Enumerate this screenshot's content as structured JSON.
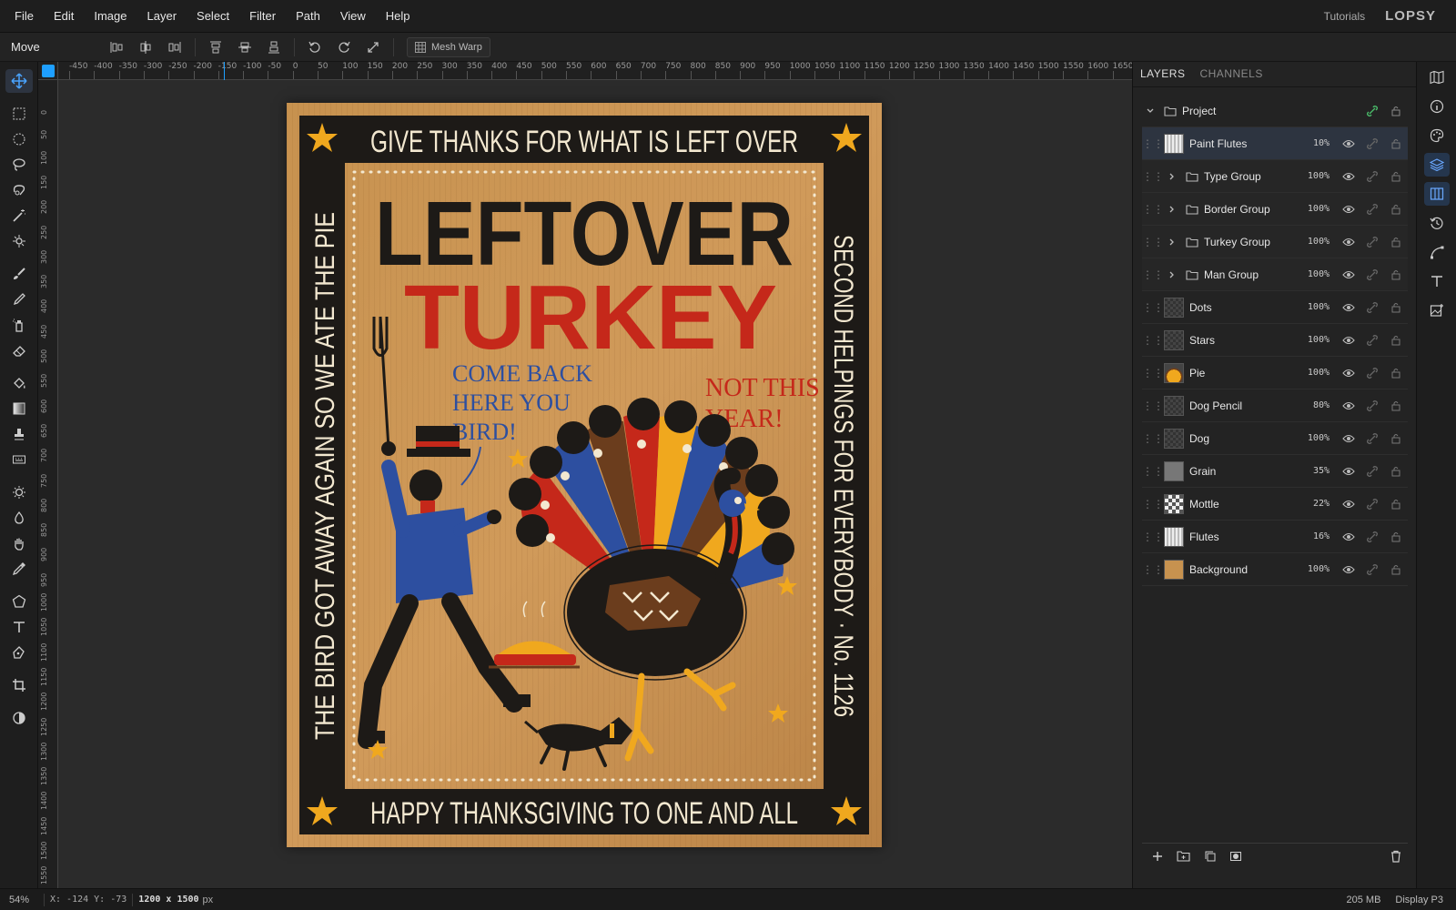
{
  "menubar": {
    "items": [
      "File",
      "Edit",
      "Image",
      "Layer",
      "Select",
      "Filter",
      "Path",
      "View",
      "Help"
    ],
    "tutorials": "Tutorials",
    "logo": "LOPSY"
  },
  "options": {
    "tool_name": "Move",
    "mesh_warp": "Mesh Warp"
  },
  "rulers": {
    "top": [
      "-450",
      "-400",
      "-350",
      "-300",
      "-250",
      "-200",
      "-150",
      "-100",
      "-50",
      "0",
      "50",
      "100",
      "150",
      "200",
      "250",
      "300",
      "350",
      "400",
      "450",
      "500",
      "550",
      "600",
      "650",
      "700",
      "750",
      "800",
      "850",
      "900",
      "950",
      "1000",
      "1050",
      "1100",
      "1150",
      "1200",
      "1250",
      "1300",
      "1350",
      "1400",
      "1450",
      "1500",
      "1550",
      "1600",
      "1650"
    ],
    "left": [
      "0",
      "50",
      "100",
      "150",
      "200",
      "250",
      "300",
      "350",
      "400",
      "450",
      "500",
      "550",
      "600",
      "650",
      "700",
      "750",
      "800",
      "850",
      "900",
      "950",
      "1000",
      "1050",
      "1100",
      "1150",
      "1200",
      "1250",
      "1300",
      "1350",
      "1400",
      "1450",
      "1500",
      "1550"
    ]
  },
  "poster": {
    "top": "GIVE THANKS FOR WHAT IS LEFT OVER",
    "bottom": "HAPPY THANKSGIVING TO ONE AND ALL",
    "left": "THE BIRD GOT AWAY AGAIN SO WE ATE THE PIE",
    "right": "SECOND HELPINGS FOR EVERYBODY · No. 1126",
    "title1": "LEFTOVER",
    "title2": "TURKEY",
    "bubble_left": [
      "COME BACK",
      "HERE YOU",
      "BIRD!"
    ],
    "bubble_right": [
      "NOT THIS",
      "YEAR!"
    ]
  },
  "panel": {
    "tabs": [
      "LAYERS",
      "CHANNELS"
    ],
    "project": "Project",
    "layers": [
      {
        "name": "Paint Flutes",
        "opacity": "10%",
        "kind": "layer",
        "thumb": "flutes",
        "selected": true
      },
      {
        "name": "Type Group",
        "opacity": "100%",
        "kind": "group"
      },
      {
        "name": "Border Group",
        "opacity": "100%",
        "kind": "group"
      },
      {
        "name": "Turkey Group",
        "opacity": "100%",
        "kind": "group"
      },
      {
        "name": "Man Group",
        "opacity": "100%",
        "kind": "group"
      },
      {
        "name": "Dots",
        "opacity": "100%",
        "kind": "layer",
        "thumb": "checker"
      },
      {
        "name": "Stars",
        "opacity": "100%",
        "kind": "layer",
        "thumb": "checker"
      },
      {
        "name": "Pie",
        "opacity": "100%",
        "kind": "layer",
        "thumb": "pie"
      },
      {
        "name": "Dog Pencil",
        "opacity": "80%",
        "kind": "layer",
        "thumb": "checker"
      },
      {
        "name": "Dog",
        "opacity": "100%",
        "kind": "layer",
        "thumb": "checker"
      },
      {
        "name": "Grain",
        "opacity": "35%",
        "kind": "layer",
        "thumb": "grain"
      },
      {
        "name": "Mottle",
        "opacity": "22%",
        "kind": "layer",
        "thumb": "mottle"
      },
      {
        "name": "Flutes",
        "opacity": "16%",
        "kind": "layer",
        "thumb": "flutes"
      },
      {
        "name": "Background",
        "opacity": "100%",
        "kind": "layer",
        "thumb": "tan"
      }
    ]
  },
  "status": {
    "zoom": "54%",
    "coords": "X: -124  Y: -73",
    "size": "1200 x 1500",
    "size_unit": "px",
    "memory": "205 MB",
    "profile": "Display P3"
  }
}
